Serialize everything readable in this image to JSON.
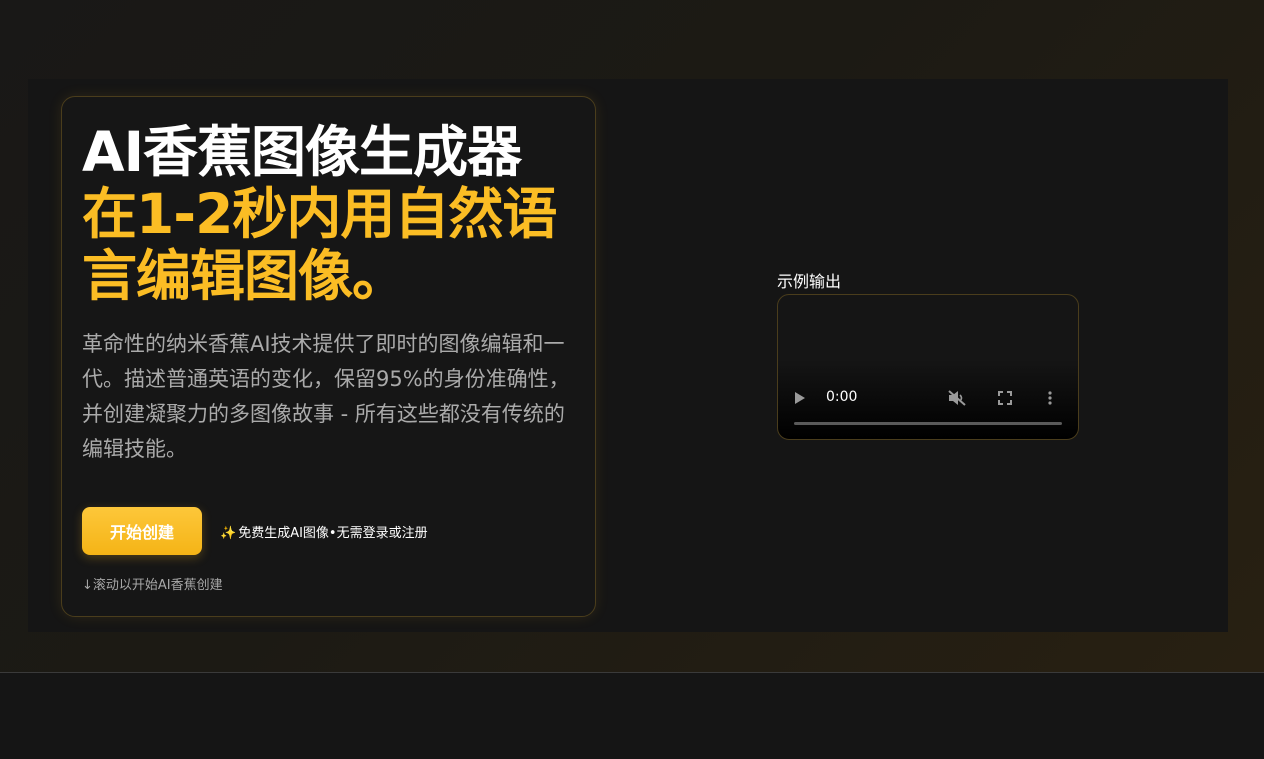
{
  "hero": {
    "title_main": "AI香蕉图像生成器",
    "title_highlight": "在1-2秒内用自然语言编辑图像。",
    "description": "革命性的纳米香蕉AI技术提供了即时的图像编辑和一代。描述普通英语的变化，保留95%的身份准确性，并创建凝聚力的多图像故事 - 所有这些都没有传统的编辑技能。",
    "start_button": "开始创建",
    "free_note_icon": "✨",
    "free_note": "免费生成AI图像•无需登录或注册",
    "scroll_hint": "↓滚动以开始AI香蕉创建"
  },
  "output": {
    "label": "示例输出",
    "video": {
      "time": "0:00",
      "progress": 0
    }
  },
  "colors": {
    "accent": "#fbbd24",
    "background": "#151515",
    "card_border": "#4a3d1c"
  },
  "icons": {
    "play": "play-icon",
    "mute": "volume-muted-icon",
    "fullscreen": "fullscreen-icon",
    "more": "more-vertical-icon",
    "sparkle": "sparkle-icon"
  }
}
